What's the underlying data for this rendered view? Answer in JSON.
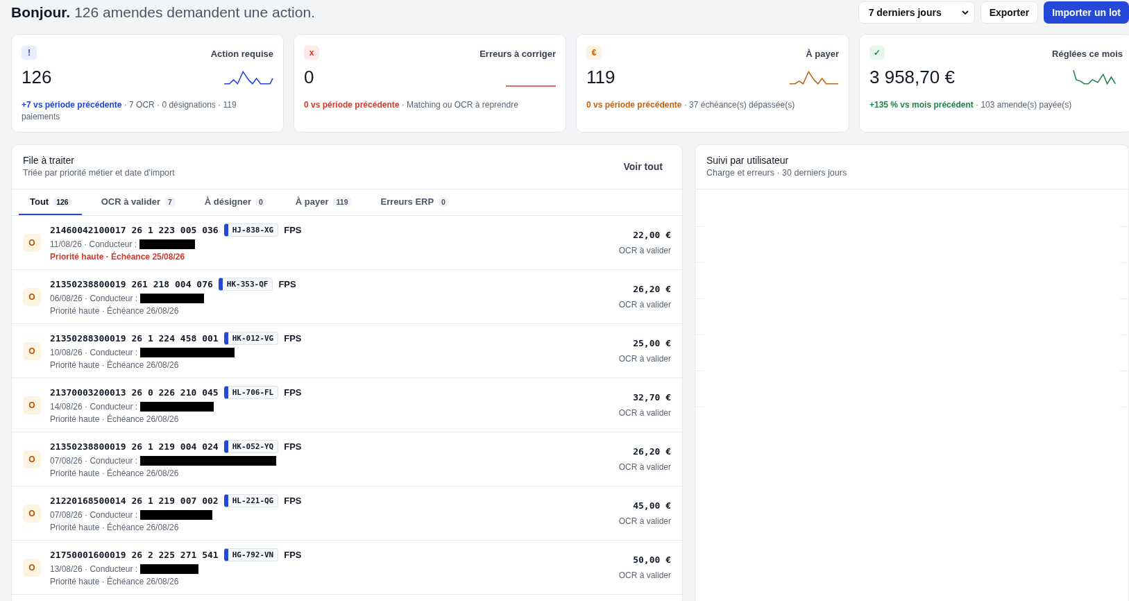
{
  "header": {
    "greeting": "Bonjour.",
    "subtitle": "126 amendes demandent une action."
  },
  "toolbar": {
    "period": "7 derniers jours",
    "buttons": [
      {
        "label": "Exporter",
        "kind": "secondary"
      },
      {
        "label": "Importer un lot",
        "kind": "primary"
      }
    ]
  },
  "stats": [
    {
      "kind": "info",
      "icon": "!",
      "title": "Action requise",
      "value": "126",
      "delta": "+7 vs période précédente",
      "detail": " · 7 OCR · 0 désignations · 119 paiements"
    },
    {
      "kind": "error",
      "icon": "x",
      "title": "Erreurs à corriger",
      "value": "0",
      "delta": "0 vs période précédente",
      "detail": " · Matching ou OCR à reprendre"
    },
    {
      "kind": "warning",
      "icon": "€",
      "title": "À payer",
      "value": "119",
      "delta": "0 vs période précédente",
      "detail": " · 37 échéance(s) dépassée(s)"
    },
    {
      "kind": "success",
      "icon": "✓",
      "title": "Réglées ce mois",
      "value": "3 958,70 €",
      "delta": "+135 % vs mois précédent",
      "detail": " · 103 amende(s) payée(s)"
    }
  ],
  "queue": {
    "title": "File à traiter",
    "subtitle": "Triée par priorité métier et date d'import",
    "link": "Voir tout",
    "tabs": [
      {
        "label": "Tout",
        "count": "126",
        "selected": true
      },
      {
        "label": "OCR à valider",
        "count": "7",
        "selected": false
      },
      {
        "label": "À désigner",
        "count": "0",
        "selected": false
      },
      {
        "label": "À payer",
        "count": "119",
        "selected": false
      },
      {
        "label": "Erreurs ERP",
        "count": "0",
        "selected": false
      }
    ],
    "rows": [
      {
        "badge": "O",
        "number": "21460042100017 26 1 223 005 036",
        "plate": "HJ-838-XG",
        "type": "FPS",
        "date": "11/08/26 · Conducteur :",
        "redacted": true,
        "priority": "Priorité haute · Échéance 25/08/26",
        "urgent": true,
        "amount": "22,00 €",
        "status": "OCR à valider"
      },
      {
        "badge": "O",
        "number": "21350238800019 261 218 004 076",
        "plate": "HK-353-QF",
        "type": "FPS",
        "date": "06/08/26 · Conducteur :",
        "redacted": true,
        "priority": "Priorité haute · Échéance 26/08/26",
        "urgent": false,
        "amount": "26,20 €",
        "status": "OCR à valider"
      },
      {
        "badge": "O",
        "number": "21350288300019 26 1 224 458 001",
        "plate": "HK-012-VG",
        "type": "FPS",
        "date": "10/08/26 · Conducteur :",
        "redacted": true,
        "priority": "Priorité haute · Échéance 26/08/26",
        "urgent": false,
        "amount": "25,00 €",
        "status": "OCR à valider"
      },
      {
        "badge": "O",
        "number": "21370003200013 26 0 226 210 045",
        "plate": "HL-706-FL",
        "type": "FPS",
        "date": "14/08/26 · Conducteur :",
        "redacted": true,
        "priority": "Priorité haute · Échéance 26/08/26",
        "urgent": false,
        "amount": "32,70 €",
        "status": "OCR à valider"
      },
      {
        "badge": "O",
        "number": "21350238800019 26 1 219 004 024",
        "plate": "HK-052-YQ",
        "type": "FPS",
        "date": "07/08/26 · Conducteur :",
        "redacted": true,
        "priority": "Priorité haute · Échéance 26/08/26",
        "urgent": false,
        "amount": "26,20 €",
        "status": "OCR à valider"
      },
      {
        "badge": "O",
        "number": "21220168500014 26 1 219 007 002",
        "plate": "HL-221-QG",
        "type": "FPS",
        "date": "07/08/26 · Conducteur :",
        "redacted": true,
        "priority": "Priorité haute · Échéance 26/08/26",
        "urgent": false,
        "amount": "45,00 €",
        "status": "OCR à valider"
      },
      {
        "badge": "O",
        "number": "21750001600019 26 2 225 271 541",
        "plate": "HG-792-VN",
        "type": "FPS",
        "date": "13/08/26 · Conducteur :",
        "redacted": true,
        "priority": "Priorité haute · Échéance 26/08/26",
        "urgent": false,
        "amount": "50,00 €",
        "status": "OCR à valider"
      }
    ]
  },
  "users": {
    "title": "Suivi par utilisateur",
    "subtitle": "Charge et erreurs · 30 derniers jours"
  }
}
